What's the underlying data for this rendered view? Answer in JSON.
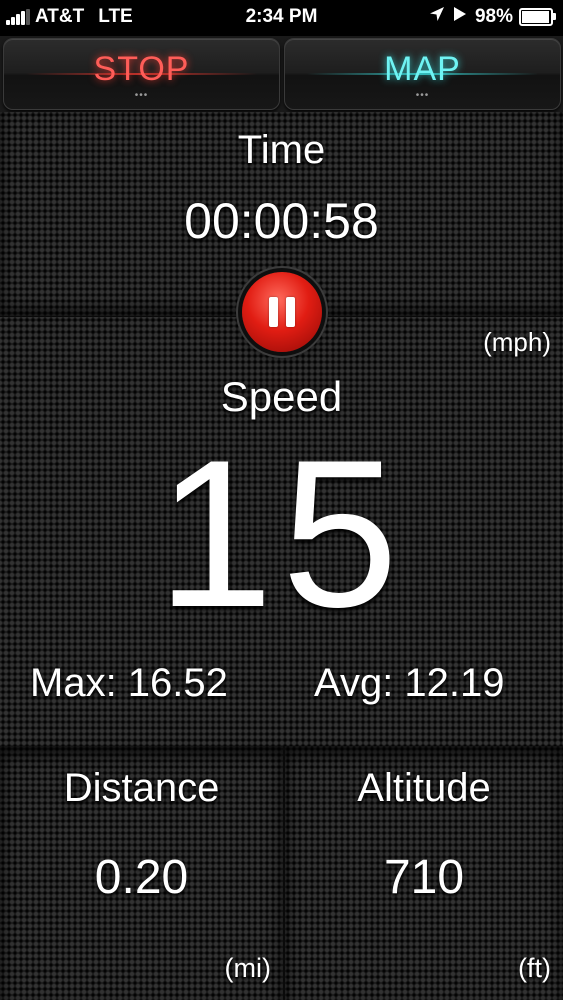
{
  "status_bar": {
    "carrier": "AT&T",
    "network": "LTE",
    "time": "2:34 PM",
    "battery": "98%",
    "battery_level": 0.98,
    "signal_bars": 4,
    "icons": [
      "signal-icon",
      "location-arrow-icon",
      "play-icon",
      "battery-icon"
    ]
  },
  "top_buttons": {
    "stop_label": "STOP",
    "map_label": "MAP",
    "stop_color": "#ff5d58",
    "map_color": "#6ff3f3"
  },
  "time_panel": {
    "label": "Time",
    "value": "00:00:58"
  },
  "speed_panel": {
    "unit": "(mph)",
    "label": "Speed",
    "value": "15",
    "max": "Max: 16.52",
    "avg": "Avg: 12.19"
  },
  "pause_button": {
    "icon": "pause-icon",
    "color": "#e11d13"
  },
  "distance_panel": {
    "label": "Distance",
    "value": "0.20",
    "unit": "(mi)"
  },
  "altitude_panel": {
    "label": "Altitude",
    "value": "710",
    "unit": "(ft)"
  }
}
